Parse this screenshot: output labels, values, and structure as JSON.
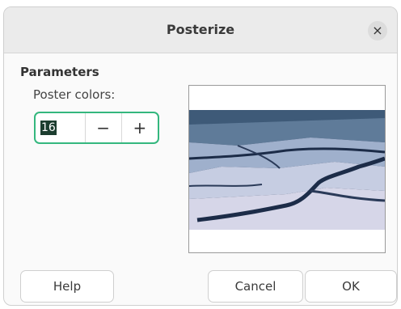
{
  "dialog": {
    "title": "Posterize",
    "close_icon": "close-icon",
    "close_glyph": "×"
  },
  "parameters": {
    "section_label": "Parameters",
    "field_label": "Poster colors:",
    "value": "16",
    "decrement_glyph": "−",
    "increment_glyph": "+"
  },
  "buttons": {
    "help": "Help",
    "cancel": "Cancel",
    "ok": "OK"
  },
  "colors": {
    "focus_accent": "#34b77e",
    "selection_bg": "#1c3d2f"
  }
}
